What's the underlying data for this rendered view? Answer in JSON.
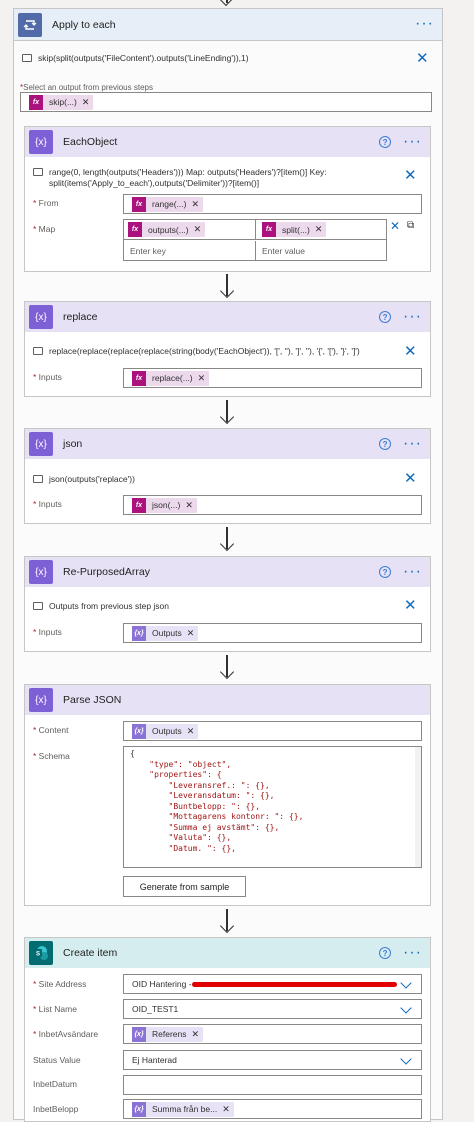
{
  "apply": {
    "title": "Apply to each",
    "comment": "skip(split(outputs('FileContent').outputs('LineEnding')),1)",
    "select_label": "Select an output from previous steps",
    "token": "skip(...)"
  },
  "each_object": {
    "title": "EachObject",
    "comment": "range(0, length(outputs('Headers'))) Map: outputs('Headers')?[item()] Key: split(items('Apply_to_each'),outputs('Delimiter'))?[item()]",
    "from_label": "From",
    "from_token": "range(...)",
    "map_label": "Map",
    "map_key_token": "outputs(...)",
    "map_value_token": "split(...)",
    "key_placeholder": "Enter key",
    "value_placeholder": "Enter value"
  },
  "replace": {
    "title": "replace",
    "comment": "replace(replace(replace(replace(string(body('EachObject')), '[', ''), ']', ''), '{', '['), '}', ']')",
    "inputs_label": "Inputs",
    "token": "replace(...)"
  },
  "json": {
    "title": "json",
    "comment": "json(outputs('replace'))",
    "inputs_label": "Inputs",
    "token": "json(...)"
  },
  "repurposed": {
    "title": "Re-PurposedArray",
    "comment": "Outputs from previous step json",
    "inputs_label": "Inputs",
    "token": "Outputs"
  },
  "parse_json": {
    "title": "Parse JSON",
    "content_label": "Content",
    "content_token": "Outputs",
    "schema_label": "Schema",
    "schema_lines": [
      "{",
      "    \"type\": \"object\",",
      "    \"properties\": {",
      "        \"Leveransref.: \": {},",
      "        \"Leveransdatum: \": {},",
      "        \"Buntbelopp: \": {},",
      "        \"Mottagarens kontonr: \": {},",
      "        \"Summa ej avstämt\": {},",
      "        \"Valuta\": {},",
      "        \"Datum. \": {},"
    ],
    "generate_button": "Generate from sample"
  },
  "create_item": {
    "title": "Create item",
    "site_label": "Site Address",
    "site_value": "OID Hantering -",
    "list_label": "List Name",
    "list_value": "OID_TEST1",
    "inbet_avsandare_label": "InbetAvsändare",
    "inbet_avsandare_token": "Referens",
    "status_label": "Status Value",
    "status_value": "Ej Hanterad",
    "inbet_datum_label": "InbetDatum",
    "inbet_datum_value": "",
    "inbet_belopp_label": "InbetBelopp",
    "inbet_belopp_token": "Summa från be..."
  },
  "icons": {
    "loop": "loop-icon",
    "variable": "curly-braces-icon",
    "sharepoint": "sharepoint-icon",
    "expression": "fx-icon",
    "close": "close-icon",
    "more": "ellipsis-icon",
    "help": "help-icon",
    "chevron": "chevron-down-icon"
  },
  "colors": {
    "accent": "#0f6cbd",
    "expression_token": "#ab127e",
    "variable_header": "#7d5fd6",
    "sharepoint": "#036c70",
    "required": "#a4262c"
  }
}
